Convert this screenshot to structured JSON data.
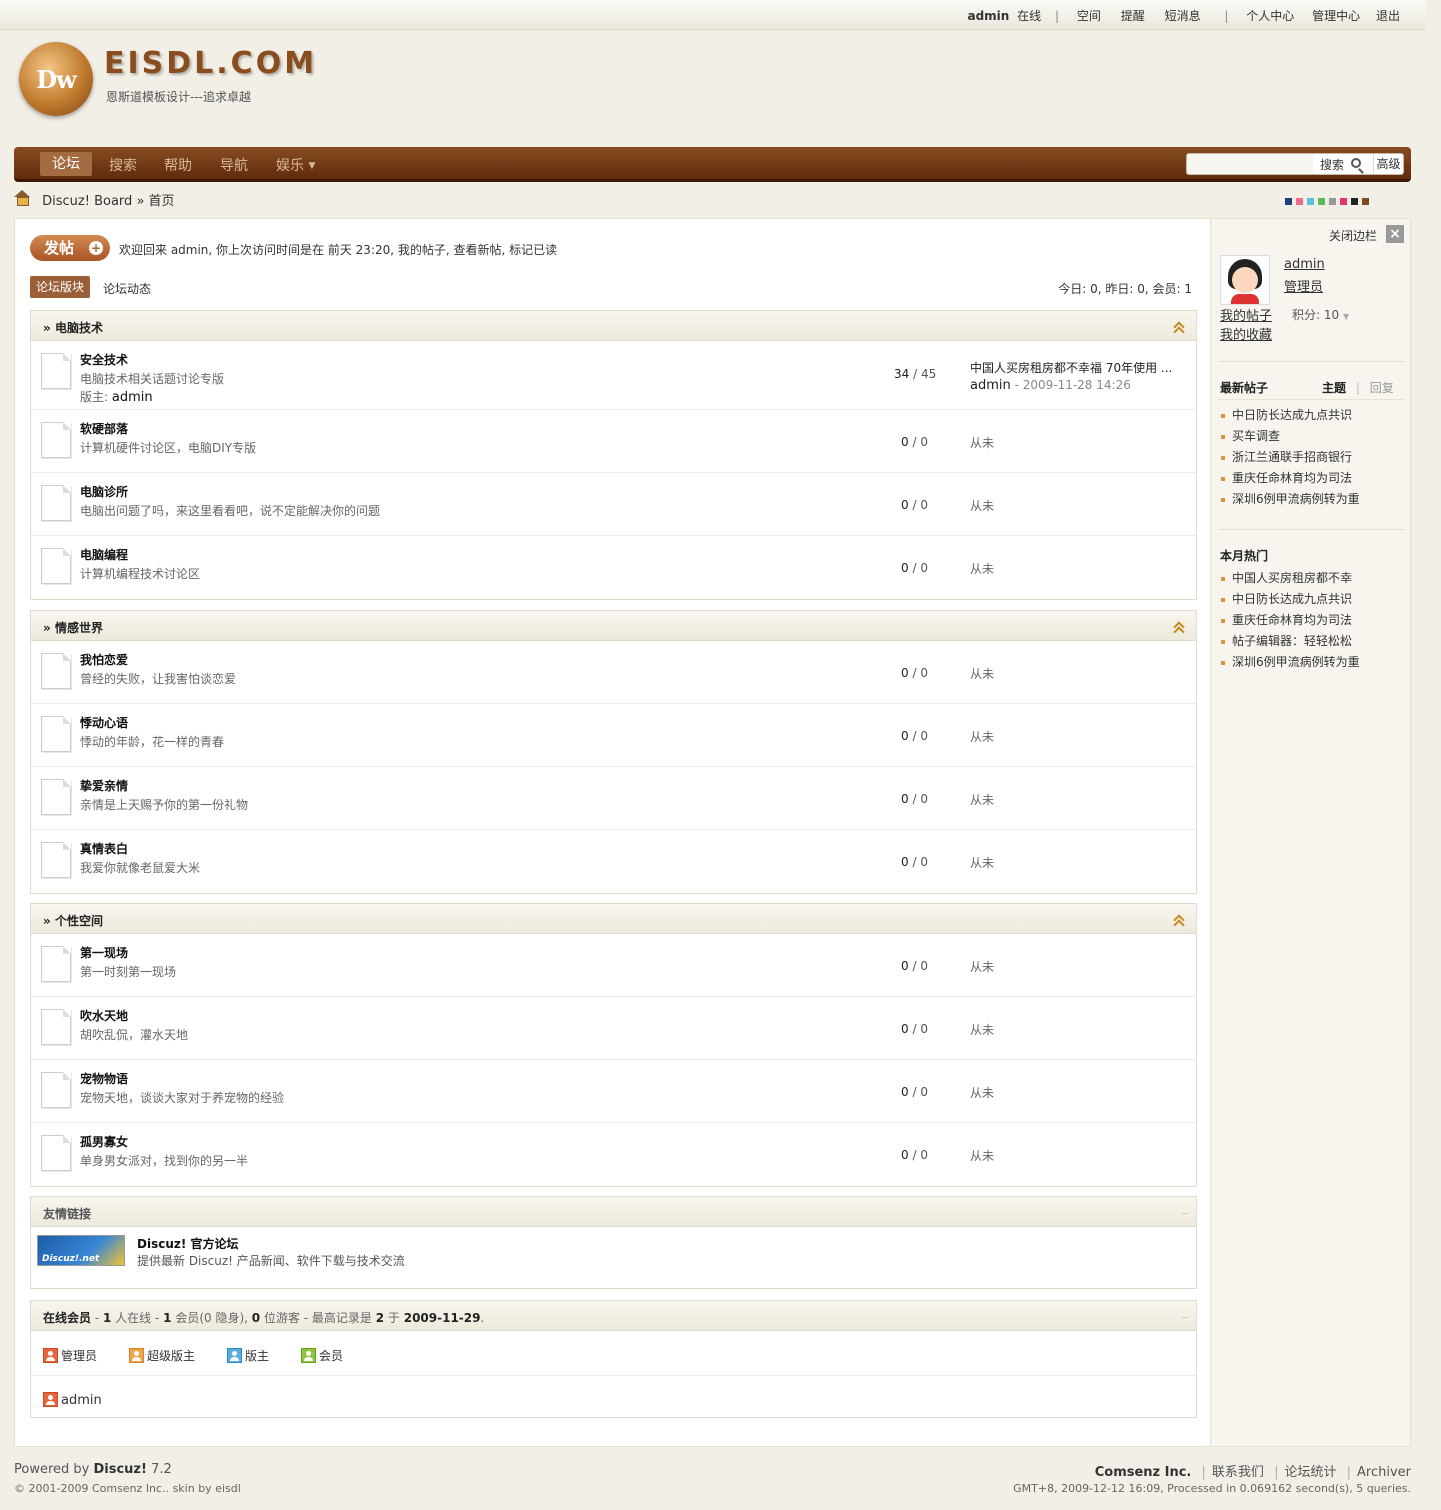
{
  "topbar": {
    "user": "admin",
    "status": "在线",
    "links": [
      "空间",
      "提醒",
      "短消息"
    ],
    "links2": [
      "个人中心",
      "管理中心",
      "退出"
    ]
  },
  "header": {
    "logo_mark": "Dw",
    "logo_text": "EISDL.COM",
    "slogan": "恩斯道模板设计---追求卓越"
  },
  "nav": {
    "items": [
      "论坛",
      "搜索",
      "帮助",
      "导航",
      "娱乐"
    ],
    "search_placeholder": "",
    "search_label": "搜索",
    "advanced_label": "高级"
  },
  "breadcrumb": {
    "board": "Discuz! Board",
    "separator": "»",
    "current": "首页"
  },
  "style_swatches": [
    "#1f3f7a",
    "#f06a8a",
    "#5bc0de",
    "#5cb85c",
    "#999999",
    "#e8336e",
    "#222222",
    "#7a4a22"
  ],
  "main": {
    "post_button": "发帖",
    "welcome": "欢迎回来  admin, 你上次访问时间是在  前天 23:20, 我的帖子, 查看新帖, 标记已读",
    "tabs": [
      "论坛版块",
      "论坛动态"
    ],
    "stats": "今日: 0, 昨日: 0, 会员: 1"
  },
  "categories": [
    {
      "title": "电脑技术",
      "forums": [
        {
          "name": "安全技术",
          "desc": "电脑技术相关话题讨论专版",
          "mod_label": "版主:",
          "mod": "admin",
          "threads": "34",
          "posts": "45",
          "last_title": "中国人买房租房都不幸福  70年使用 ...",
          "last_user": "admin",
          "last_time": "- 2009-11-28 14:26"
        },
        {
          "name": "软硬部落",
          "desc": "计算机硬件讨论区，电脑DIY专版",
          "threads": "0",
          "posts": "0",
          "last": "从未"
        },
        {
          "name": "电脑诊所",
          "desc": "电脑出问题了吗，来这里看看吧，说不定能解决你的问题",
          "threads": "0",
          "posts": "0",
          "last": "从未"
        },
        {
          "name": "电脑编程",
          "desc": "计算机编程技术讨论区",
          "threads": "0",
          "posts": "0",
          "last": "从未"
        }
      ]
    },
    {
      "title": "情感世界",
      "forums": [
        {
          "name": "我怕恋爱",
          "desc": "曾经的失败，让我害怕谈恋爱",
          "threads": "0",
          "posts": "0",
          "last": "从未"
        },
        {
          "name": "悸动心语",
          "desc": "悸动的年龄，花一样的青春",
          "threads": "0",
          "posts": "0",
          "last": "从未"
        },
        {
          "name": "挚爱亲情",
          "desc": "亲情是上天赐予你的第一份礼物",
          "threads": "0",
          "posts": "0",
          "last": "从未"
        },
        {
          "name": "真情表白",
          "desc": "我爱你就像老鼠爱大米",
          "threads": "0",
          "posts": "0",
          "last": "从未"
        }
      ]
    },
    {
      "title": "个性空间",
      "forums": [
        {
          "name": "第一现场",
          "desc": "第一时刻第一现场",
          "threads": "0",
          "posts": "0",
          "last": "从未"
        },
        {
          "name": "吹水天地",
          "desc": "胡吹乱侃，灌水天地",
          "threads": "0",
          "posts": "0",
          "last": "从未"
        },
        {
          "name": "宠物物语",
          "desc": "宠物天地，谈谈大家对于养宠物的经验",
          "threads": "0",
          "posts": "0",
          "last": "从未"
        },
        {
          "name": "孤男寡女",
          "desc": "单身男女派对，找到你的另一半",
          "threads": "0",
          "posts": "0",
          "last": "从未"
        }
      ]
    }
  ],
  "links_box": {
    "title": "友情链接",
    "logo_text": "Discuz!.net",
    "name": "Discuz! 官方论坛",
    "desc": "提供最新  Discuz! 产品新闻、软件下载与技术交流"
  },
  "online": {
    "title": "在线会员",
    "info_pre": "- ",
    "online_count": "1",
    "info_1": " 人在线  - ",
    "member_count": "1",
    "info_2": " 会员(0 隐身), ",
    "guest_count": "0",
    "info_3": " 位游客  - 最高记录是 ",
    "record": "2",
    "info_4": " 于 ",
    "record_date": "2009-11-29",
    "info_5": ".",
    "legend": [
      "管理员",
      "超级版主",
      "版主",
      "会员"
    ],
    "users": [
      "admin"
    ]
  },
  "sidebar": {
    "close_label": "关闭边栏",
    "close_icon": "×",
    "user": "admin",
    "role": "管理员",
    "my_posts": "我的帖子",
    "my_favorites": "我的收藏",
    "points": "积分: 10",
    "latest_title": "最新帖子",
    "tab_threads": "主题",
    "tab_replies": "回复",
    "latest": [
      "中日防长达成九点共识",
      "买车调查",
      "浙江兰通联手招商银行",
      "重庆任命林育均为司法",
      "深圳6例甲流病例转为重"
    ],
    "hot_title": "本月热门",
    "hot": [
      "中国人买房租房都不幸",
      "中日防长达成九点共识",
      "重庆任命林育均为司法",
      "帖子编辑器：轻轻松松",
      "深圳6例甲流病例转为重"
    ]
  },
  "footer": {
    "powered": "Powered by ",
    "product": "Discuz!",
    "version": " 7.2",
    "copyright": "© 2001-2009 Comsenz Inc..   skin by eisdl",
    "company": "Comsenz Inc.",
    "links": [
      "联系我们",
      "论坛统计",
      "Archiver"
    ],
    "processed": "GMT+8, 2009-12-12 16:09, Processed in 0.069162 second(s), 5 queries."
  }
}
